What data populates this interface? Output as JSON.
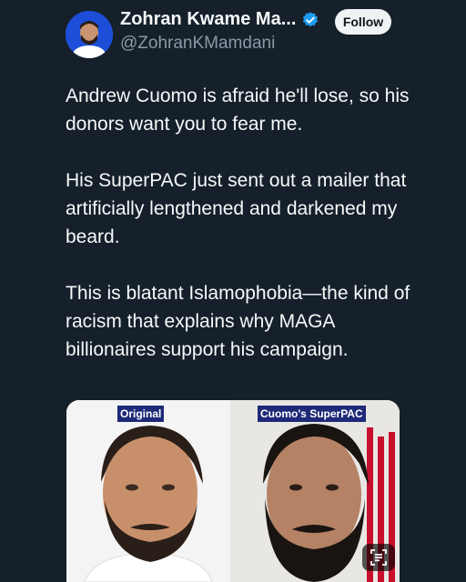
{
  "author": {
    "name": "Zohran Kwame Ma...",
    "handle": "@ZohranKMamdani",
    "verified": true
  },
  "follow_label": "Follow",
  "tweet": {
    "paragraphs": [
      "Andrew Cuomo is afraid he'll lose, so his donors want you to fear me.",
      "His SuperPAC just sent out a mailer that artificially lengthened and darkened my beard.",
      "This is blatant Islamophobia—the kind of racism that explains why MAGA billionaires support his campaign."
    ]
  },
  "media": {
    "left_label": "Original",
    "right_label": "Cuomo's SuperPAC"
  },
  "colors": {
    "background": "#15202b",
    "verified": "#1d9bf0",
    "label_bg": "#1e2a78"
  },
  "icons": [
    "verified-badge-icon",
    "alt-text-icon"
  ]
}
